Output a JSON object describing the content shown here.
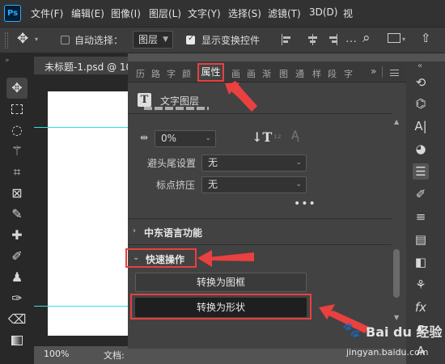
{
  "app": {
    "logo": "Ps"
  },
  "menubar": {
    "items": [
      "文件(F)",
      "编辑(E)",
      "图像(I)",
      "图层(L)",
      "文字(Y)",
      "选择(S)",
      "滤镜(T)",
      "3D(D)",
      "视"
    ]
  },
  "options": {
    "auto_select_label": "自动选择：",
    "auto_select_checked": false,
    "layer_select_value": "图层",
    "show_transform_label": "显示变换控件",
    "show_transform_checked": true
  },
  "document": {
    "tab_title": "未标题-1.psd @ 10",
    "zoom": "100%",
    "status_info": "文档:"
  },
  "panel": {
    "tabs": [
      "历",
      "路",
      "字",
      "颜",
      "属性",
      "画",
      "画",
      "渐",
      "图",
      "通",
      "样",
      "段",
      "字"
    ],
    "active_tab": "属性",
    "layer_kind_icon": "T",
    "layer_kind": "文字图层",
    "tracking_value": "0%",
    "kinsoku_label": "避头尾设置",
    "kinsoku_value": "无",
    "mojikumi_label": "标点挤压",
    "mojikumi_value": "无",
    "more": "•••",
    "section_cjk": "中东语言功能",
    "section_quick": "快速操作",
    "btn_convert_frame": "转换为图框",
    "btn_convert_shape": "转换为形状"
  },
  "watermark": {
    "text": "Bai du 经验",
    "url": "jingyan.baidu.com"
  },
  "colors": {
    "highlight": "#e94040",
    "guide": "#33e0e0"
  }
}
